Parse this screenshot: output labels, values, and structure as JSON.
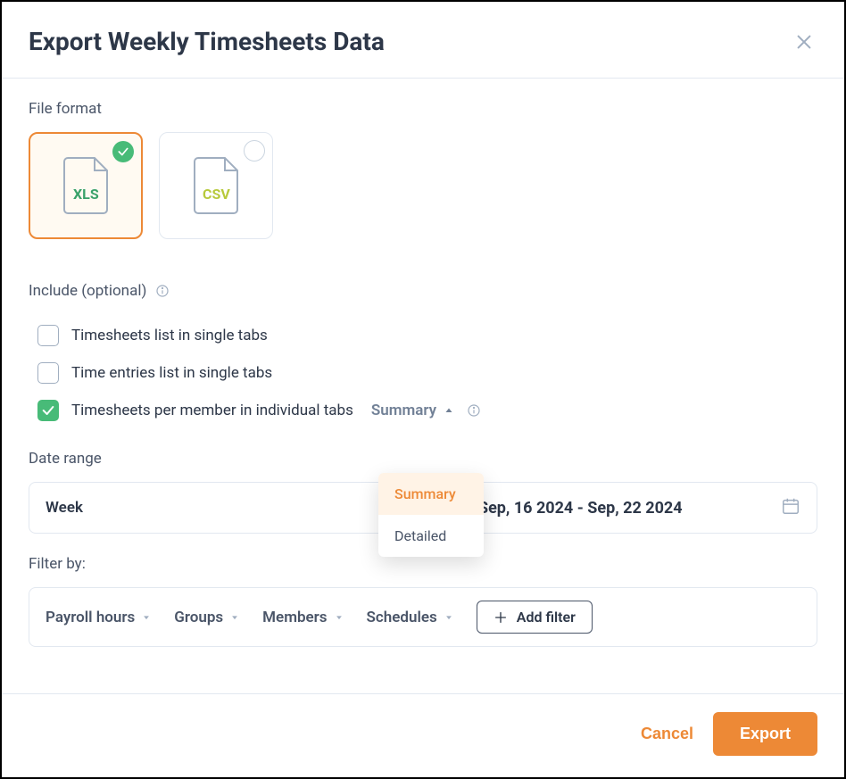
{
  "title": "Export Weekly Timesheets Data",
  "file_format": {
    "label": "File format",
    "options": [
      {
        "id": "xls",
        "label": "XLS",
        "selected": true
      },
      {
        "id": "csv",
        "label": "CSV",
        "selected": false
      }
    ]
  },
  "include": {
    "label": "Include (optional)",
    "items": [
      {
        "label": "Timesheets list in single tabs",
        "checked": false
      },
      {
        "label": "Time entries list in single tabs",
        "checked": false
      },
      {
        "label": "Timesheets per member in individual tabs",
        "checked": true
      }
    ],
    "detail_select": {
      "value": "Summary",
      "options": [
        {
          "label": "Summary",
          "active": true
        },
        {
          "label": "Detailed",
          "active": false
        }
      ]
    }
  },
  "date": {
    "label": "Date range",
    "period": "Week",
    "range": "Sep, 16 2024 - Sep, 22 2024"
  },
  "filter": {
    "label": "Filter by:",
    "chips": [
      "Payroll hours",
      "Groups",
      "Members",
      "Schedules"
    ],
    "add_label": "Add filter"
  },
  "footer": {
    "cancel": "Cancel",
    "export": "Export"
  }
}
